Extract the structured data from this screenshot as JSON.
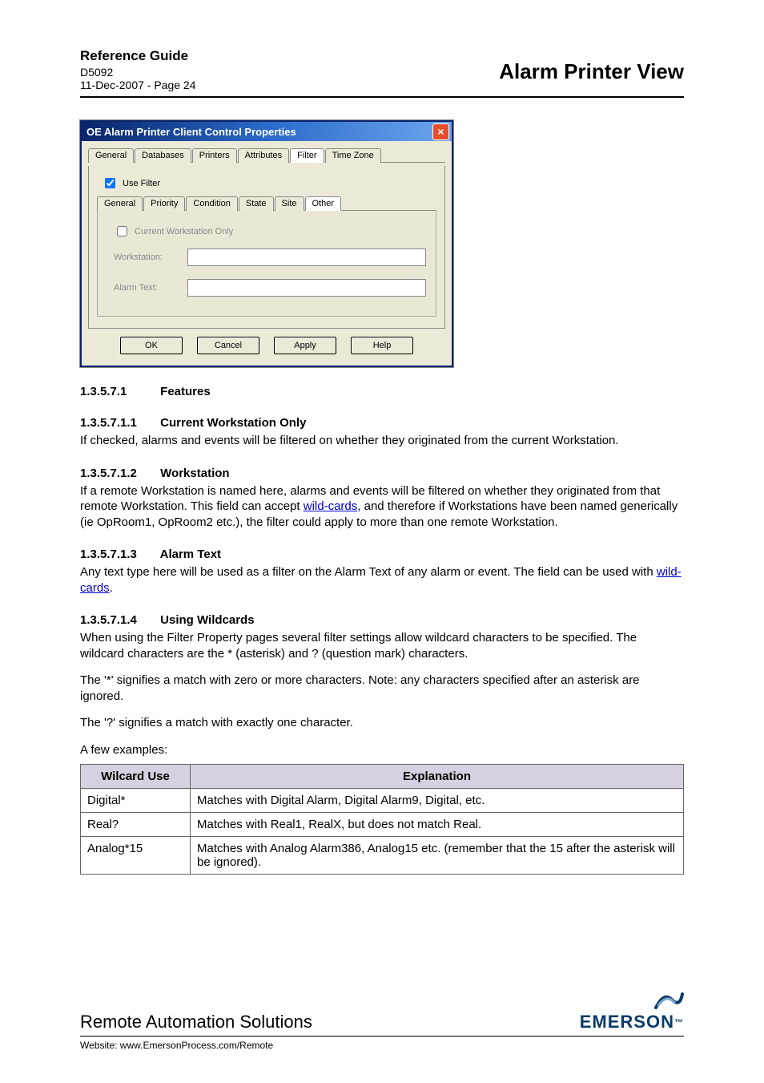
{
  "header": {
    "guide_title": "Reference Guide",
    "doc_id": "D5092",
    "date_page": "11-Dec-2007 - Page 24",
    "page_title": "Alarm Printer View"
  },
  "dialog": {
    "title": "OE Alarm Printer Client Control Properties",
    "close_icon": "×",
    "tabs": [
      "General",
      "Databases",
      "Printers",
      "Attributes",
      "Filter",
      "Time Zone"
    ],
    "active_tab": "Filter",
    "use_filter_label": "Use Filter",
    "inner_tabs": [
      "General",
      "Priority",
      "Condition",
      "State",
      "Site",
      "Other"
    ],
    "inner_active": "Other",
    "current_ws_only_label": "Current Workstation Only",
    "workstation_label": "Workstation:",
    "alarm_text_label": "Alarm Text:",
    "buttons": {
      "ok": "OK",
      "cancel": "Cancel",
      "apply": "Apply",
      "help": "Help"
    }
  },
  "sections": {
    "s1": {
      "num": "1.3.5.7.1",
      "title": "Features"
    },
    "s2": {
      "num": "1.3.5.7.1.1",
      "title": "Current Workstation Only",
      "body": "If checked, alarms and events will be filtered on whether they originated from the current Workstation."
    },
    "s3": {
      "num": "1.3.5.7.1.2",
      "title": "Workstation",
      "body_a": "If a remote Workstation is named here, alarms and events will be filtered on whether they originated from that remote Workstation. This field can accept ",
      "link": "wild-cards",
      "body_b": ", and therefore if Workstations have been named generically (ie OpRoom1, OpRoom2 etc.), the filter could apply to more than one remote Workstation."
    },
    "s4": {
      "num": "1.3.5.7.1.3",
      "title": "Alarm Text",
      "body_a": "Any text type here will be used as a filter on the Alarm Text of any alarm or event. The field can be  used with ",
      "link": "wild-cards",
      "body_b": "."
    },
    "s5": {
      "num": "1.3.5.7.1.4",
      "title": "Using Wildcards",
      "p1": "When using the Filter Property pages several filter settings allow wildcard characters to be specified. The wildcard characters are the * (asterisk) and ? (question mark) characters.",
      "p2": "The '*' signifies a match with zero or more characters. Note: any characters specified after an asterisk are ignored.",
      "p3": "The '?' signifies a match with exactly one character.",
      "p4": "A few examples:"
    }
  },
  "table": {
    "h1": "Wilcard Use",
    "h2": "Explanation",
    "rows": [
      {
        "c1": "Digital*",
        "c2": "Matches with Digital Alarm, Digital Alarm9, Digital, etc."
      },
      {
        "c1": "Real?",
        "c2": "Matches with Real1, RealX, but does not match Real."
      },
      {
        "c1": "Analog*15",
        "c2": "Matches with Analog Alarm386, Analog15 etc. (remember that the 15 after the asterisk will be ignored)."
      }
    ]
  },
  "footer": {
    "company": "Remote Automation Solutions",
    "brand": "EMERSON",
    "site_label": "Website:  www.EmersonProcess.com/Remote"
  }
}
